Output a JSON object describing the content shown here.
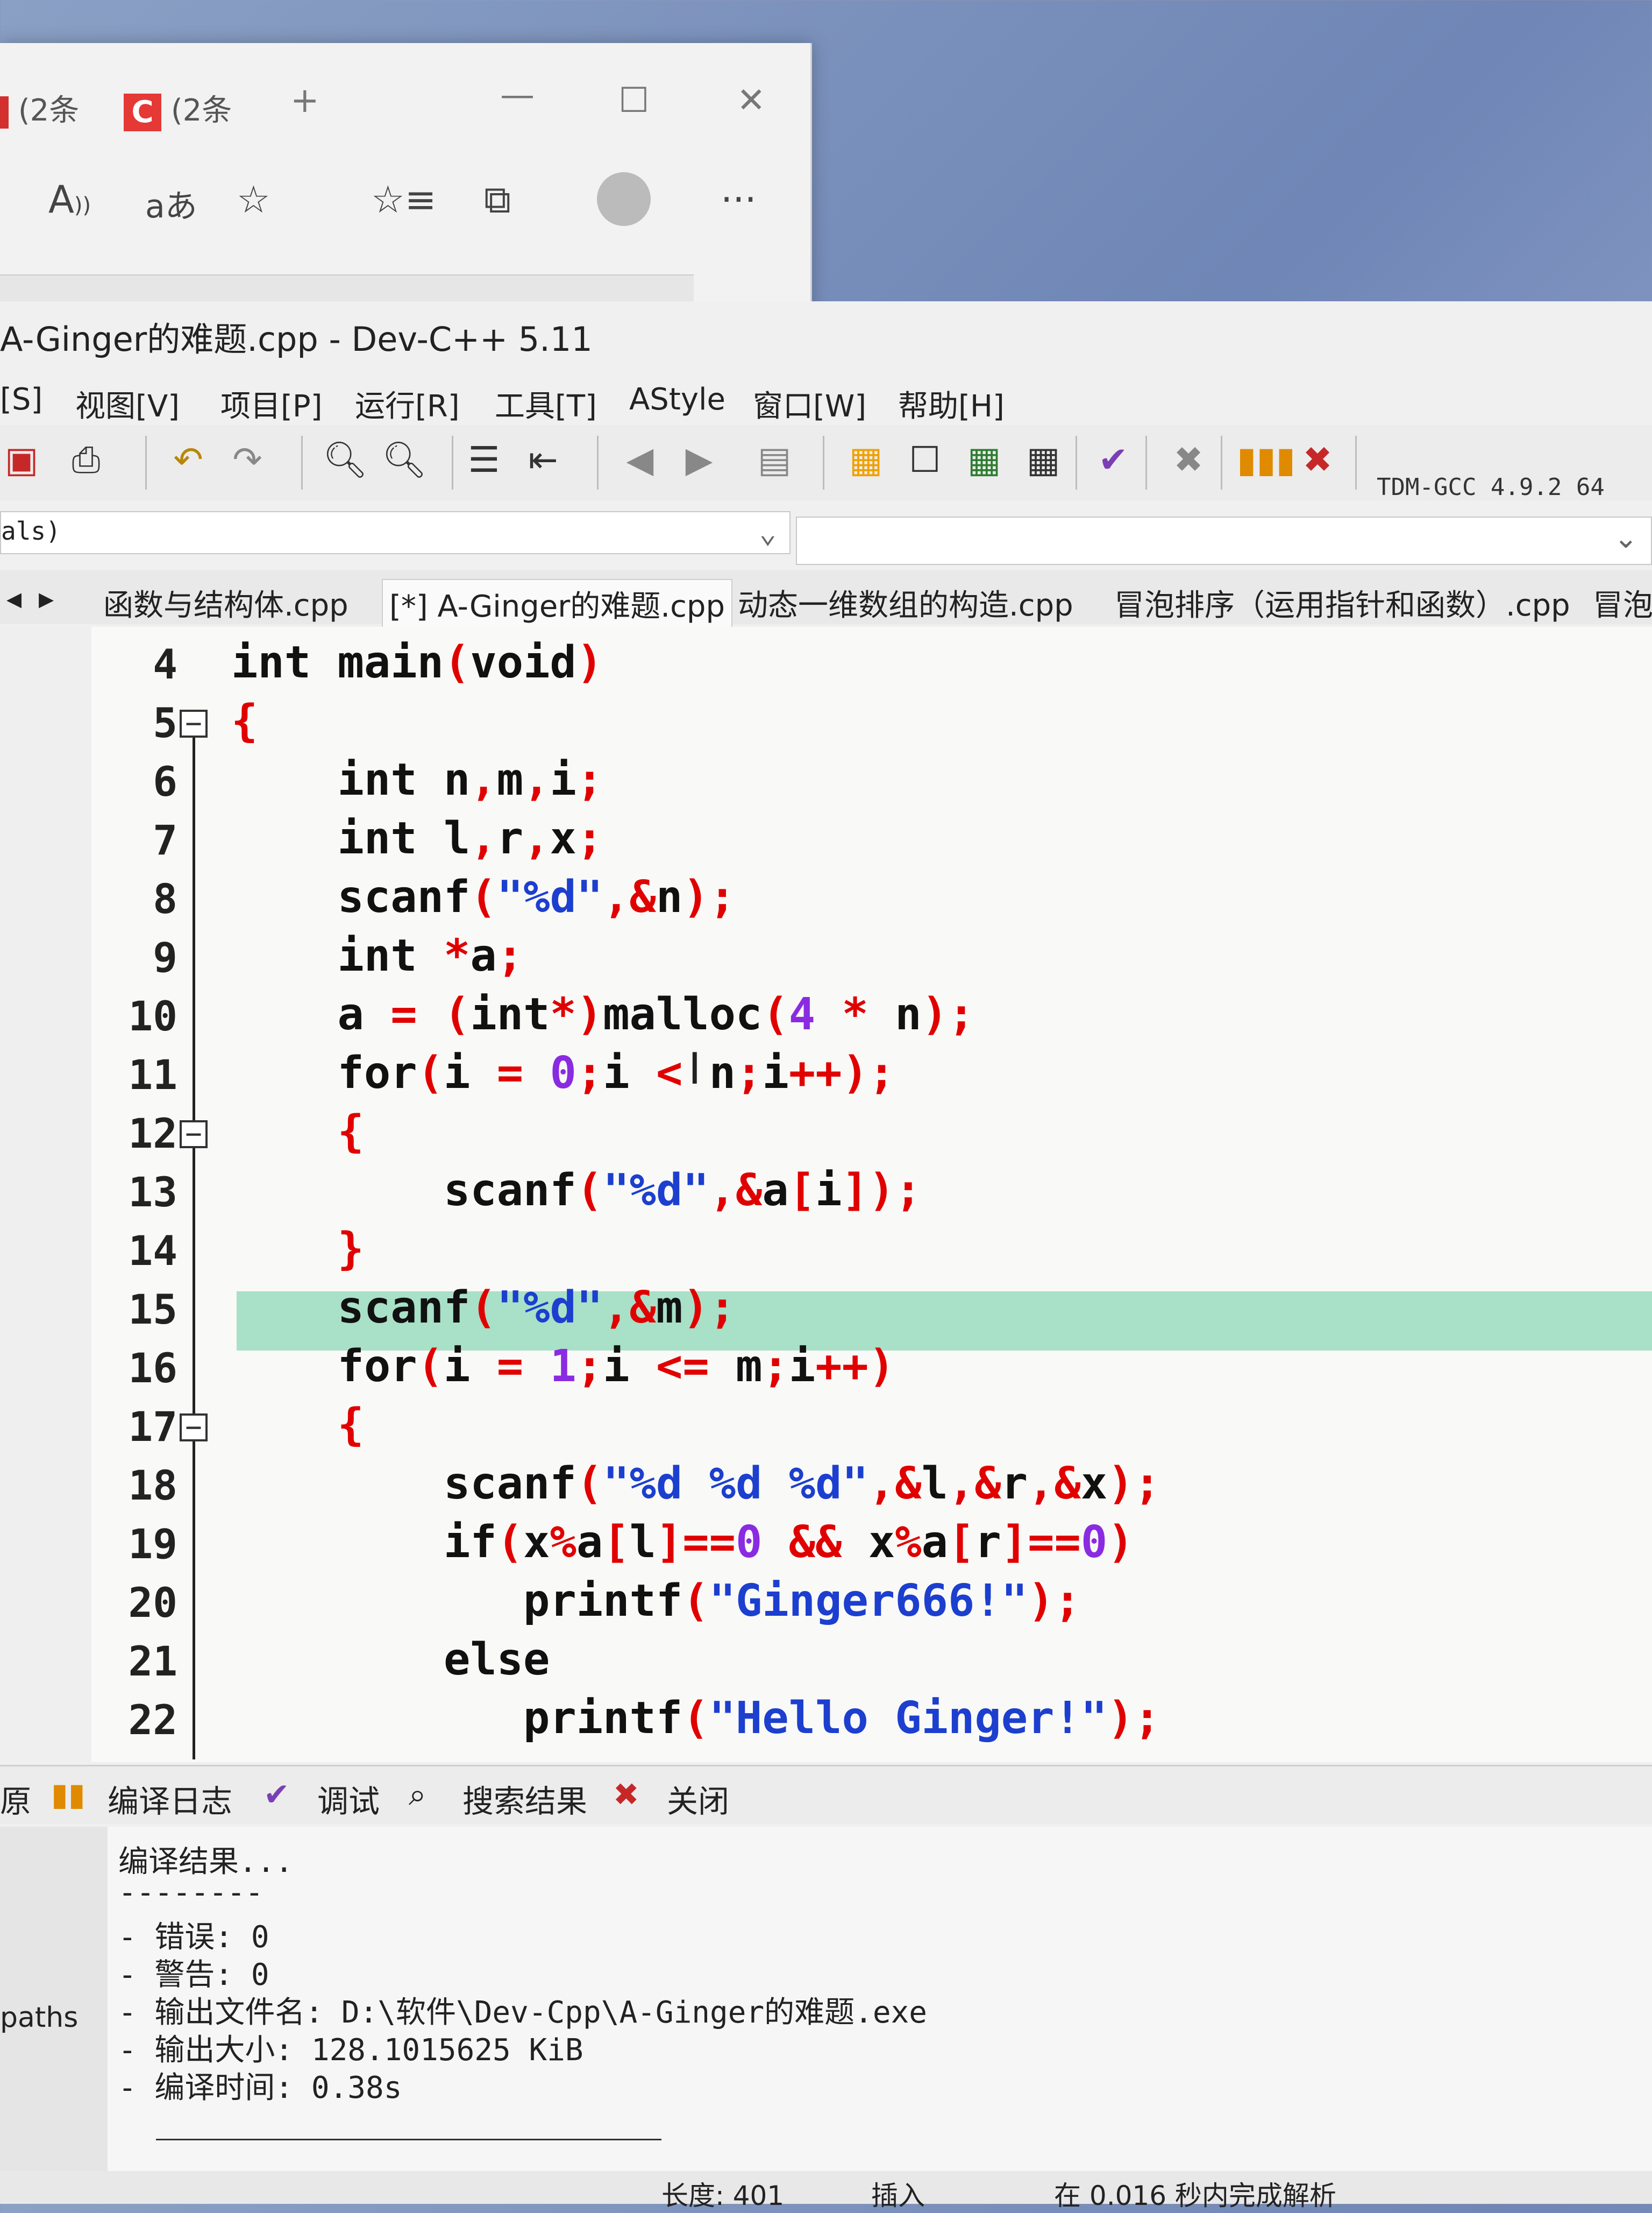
{
  "browser": {
    "tabs": [
      {
        "label": "(2条"
      },
      {
        "label": "(2条"
      }
    ],
    "new_tab": "+",
    "minimize": "—",
    "maximize": "☐",
    "close": "✕",
    "toolbar_icons": [
      "read-aloud-icon",
      "translate-icon",
      "favorite-add-icon",
      "favorites-icon",
      "collections-icon",
      "profile-icon",
      "more-icon"
    ],
    "read_aloud": "A",
    "translate": "aあ",
    "more": "···"
  },
  "window": {
    "title": "A-Ginger的难题.cpp - Dev-C++ 5.11"
  },
  "menu": [
    {
      "label": "[S]"
    },
    {
      "label": "视图[V]"
    },
    {
      "label": "项目[P]"
    },
    {
      "label": "运行[R]"
    },
    {
      "label": "工具[T]"
    },
    {
      "label": "AStyle"
    },
    {
      "label": "窗口[W]"
    },
    {
      "label": "帮助[H]"
    }
  ],
  "compiler": "TDM-GCC 4.9.2 64",
  "combo": {
    "left_value": "als)"
  },
  "file_tabs": [
    {
      "label": "函数与结构体.cpp",
      "active": false
    },
    {
      "label": "[*] A-Ginger的难题.cpp",
      "active": true
    },
    {
      "label": "动态一维数组的构造.cpp",
      "active": false
    },
    {
      "label": "冒泡排序（运用指针和函数）.cpp",
      "active": false
    },
    {
      "label": "冒泡",
      "active": false
    }
  ],
  "editor": {
    "highlighted_line": 15,
    "lines": [
      {
        "num": "4",
        "tokens": [
          {
            "t": "int main",
            "c": "k"
          },
          {
            "t": "(",
            "c": "p"
          },
          {
            "t": "void",
            "c": "k"
          },
          {
            "t": ")",
            "c": "p"
          }
        ]
      },
      {
        "num": "5",
        "fold": "⊟",
        "tokens": [
          {
            "t": "{",
            "c": "p"
          }
        ]
      },
      {
        "num": "6",
        "tokens": [
          {
            "t": "    int n",
            "c": "k"
          },
          {
            "t": ",",
            "c": "p"
          },
          {
            "t": "m",
            "c": "k"
          },
          {
            "t": ",",
            "c": "p"
          },
          {
            "t": "i",
            "c": "k"
          },
          {
            "t": ";",
            "c": "p"
          }
        ]
      },
      {
        "num": "7",
        "tokens": [
          {
            "t": "    int l",
            "c": "k"
          },
          {
            "t": ",",
            "c": "p"
          },
          {
            "t": "r",
            "c": "k"
          },
          {
            "t": ",",
            "c": "p"
          },
          {
            "t": "x",
            "c": "k"
          },
          {
            "t": ";",
            "c": "p"
          }
        ]
      },
      {
        "num": "8",
        "tokens": [
          {
            "t": "    scanf",
            "c": "k"
          },
          {
            "t": "(",
            "c": "p"
          },
          {
            "t": "\"%d\"",
            "c": "s"
          },
          {
            "t": ",&",
            "c": "p"
          },
          {
            "t": "n",
            "c": "k"
          },
          {
            "t": ");",
            "c": "p"
          }
        ]
      },
      {
        "num": "9",
        "tokens": [
          {
            "t": "    int ",
            "c": "k"
          },
          {
            "t": "*",
            "c": "p"
          },
          {
            "t": "a",
            "c": "k"
          },
          {
            "t": ";",
            "c": "p"
          }
        ]
      },
      {
        "num": "10",
        "tokens": [
          {
            "t": "    a ",
            "c": "k"
          },
          {
            "t": "= (",
            "c": "p"
          },
          {
            "t": "int",
            "c": "k"
          },
          {
            "t": "*)",
            "c": "p"
          },
          {
            "t": "malloc",
            "c": "k"
          },
          {
            "t": "(",
            "c": "p"
          },
          {
            "t": "4",
            "c": "n"
          },
          {
            "t": " * ",
            "c": "p"
          },
          {
            "t": "n",
            "c": "k"
          },
          {
            "t": ");",
            "c": "p"
          }
        ]
      },
      {
        "num": "11",
        "tokens": [
          {
            "t": "    for",
            "c": "k"
          },
          {
            "t": "(",
            "c": "p"
          },
          {
            "t": "i ",
            "c": "k"
          },
          {
            "t": "= ",
            "c": "p"
          },
          {
            "t": "0",
            "c": "n"
          },
          {
            "t": ";",
            "c": "p"
          },
          {
            "t": "i ",
            "c": "k"
          },
          {
            "t": "< ",
            "c": "p"
          },
          {
            "t": "n",
            "c": "k"
          },
          {
            "t": ";",
            "c": "p"
          },
          {
            "t": "i",
            "c": "k"
          },
          {
            "t": "++);",
            "c": "p"
          }
        ]
      },
      {
        "num": "12",
        "fold": "⊟",
        "tokens": [
          {
            "t": "    ",
            "c": "k"
          },
          {
            "t": "{",
            "c": "p"
          }
        ]
      },
      {
        "num": "13",
        "tokens": [
          {
            "t": "        scanf",
            "c": "k"
          },
          {
            "t": "(",
            "c": "p"
          },
          {
            "t": "\"%d\"",
            "c": "s"
          },
          {
            "t": ",&",
            "c": "p"
          },
          {
            "t": "a",
            "c": "k"
          },
          {
            "t": "[",
            "c": "p"
          },
          {
            "t": "i",
            "c": "k"
          },
          {
            "t": "]);",
            "c": "p"
          }
        ]
      },
      {
        "num": "14",
        "tokens": [
          {
            "t": "    ",
            "c": "k"
          },
          {
            "t": "}",
            "c": "p"
          }
        ]
      },
      {
        "num": "15",
        "tokens": [
          {
            "t": "    scanf",
            "c": "k"
          },
          {
            "t": "(",
            "c": "p"
          },
          {
            "t": "\"%d\"",
            "c": "s"
          },
          {
            "t": ",&",
            "c": "p"
          },
          {
            "t": "m",
            "c": "k"
          },
          {
            "t": ");",
            "c": "p"
          }
        ]
      },
      {
        "num": "16",
        "tokens": [
          {
            "t": "    for",
            "c": "k"
          },
          {
            "t": "(",
            "c": "p"
          },
          {
            "t": "i ",
            "c": "k"
          },
          {
            "t": "= ",
            "c": "p"
          },
          {
            "t": "1",
            "c": "n"
          },
          {
            "t": ";",
            "c": "p"
          },
          {
            "t": "i ",
            "c": "k"
          },
          {
            "t": "<= ",
            "c": "p"
          },
          {
            "t": "m",
            "c": "k"
          },
          {
            "t": ";",
            "c": "p"
          },
          {
            "t": "i",
            "c": "k"
          },
          {
            "t": "++)",
            "c": "p"
          }
        ]
      },
      {
        "num": "17",
        "fold": "⊟",
        "tokens": [
          {
            "t": "    ",
            "c": "k"
          },
          {
            "t": "{",
            "c": "p"
          }
        ]
      },
      {
        "num": "18",
        "tokens": [
          {
            "t": "        scanf",
            "c": "k"
          },
          {
            "t": "(",
            "c": "p"
          },
          {
            "t": "\"%d %d %d\"",
            "c": "s"
          },
          {
            "t": ",&",
            "c": "p"
          },
          {
            "t": "l",
            "c": "k"
          },
          {
            "t": ",&",
            "c": "p"
          },
          {
            "t": "r",
            "c": "k"
          },
          {
            "t": ",&",
            "c": "p"
          },
          {
            "t": "x",
            "c": "k"
          },
          {
            "t": ");",
            "c": "p"
          }
        ]
      },
      {
        "num": "19",
        "tokens": [
          {
            "t": "        if",
            "c": "k"
          },
          {
            "t": "(",
            "c": "p"
          },
          {
            "t": "x",
            "c": "k"
          },
          {
            "t": "%",
            "c": "p"
          },
          {
            "t": "a",
            "c": "k"
          },
          {
            "t": "[",
            "c": "p"
          },
          {
            "t": "l",
            "c": "k"
          },
          {
            "t": "]==",
            "c": "p"
          },
          {
            "t": "0",
            "c": "n"
          },
          {
            "t": " && ",
            "c": "p"
          },
          {
            "t": "x",
            "c": "k"
          },
          {
            "t": "%",
            "c": "p"
          },
          {
            "t": "a",
            "c": "k"
          },
          {
            "t": "[",
            "c": "p"
          },
          {
            "t": "r",
            "c": "k"
          },
          {
            "t": "]==",
            "c": "p"
          },
          {
            "t": "0",
            "c": "n"
          },
          {
            "t": ")",
            "c": "p"
          }
        ]
      },
      {
        "num": "20",
        "tokens": [
          {
            "t": "           printf",
            "c": "k"
          },
          {
            "t": "(",
            "c": "p"
          },
          {
            "t": "\"Ginger666!\"",
            "c": "s"
          },
          {
            "t": ");",
            "c": "p"
          }
        ]
      },
      {
        "num": "21",
        "tokens": [
          {
            "t": "        else",
            "c": "k"
          }
        ]
      },
      {
        "num": "22",
        "tokens": [
          {
            "t": "           printf",
            "c": "k"
          },
          {
            "t": "(",
            "c": "p"
          },
          {
            "t": "\"Hello Ginger!\"",
            "c": "s"
          },
          {
            "t": ");",
            "c": "p"
          }
        ]
      }
    ]
  },
  "bottom_tabs": [
    {
      "label": "原",
      "icon": ""
    },
    {
      "label": "编译日志",
      "icon": "chart-icon"
    },
    {
      "label": "调试",
      "icon": "check-icon"
    },
    {
      "label": "搜索结果",
      "icon": "search-icon"
    },
    {
      "label": "关闭",
      "icon": "close-icon"
    }
  ],
  "output": {
    "lines": [
      "编译结果...",
      "--------",
      "- 错误: 0",
      "- 警告: 0",
      "- 输出文件名: D:\\软件\\Dev-Cpp\\A-Ginger的难题.exe",
      "- 输出大小: 128.1015625 KiB",
      "- 编译时间: 0.38s"
    ]
  },
  "left_panel": {
    "paths_label": "paths"
  },
  "status": {
    "length": "长度: 401",
    "mode": "插入",
    "parse": "在 0.016 秒内完成解析"
  },
  "colors": {
    "keyword": "#111111",
    "punct": "#e00000",
    "string": "#1c3fcf",
    "number": "#8a2be2",
    "highlight": "#a8e0c8"
  }
}
